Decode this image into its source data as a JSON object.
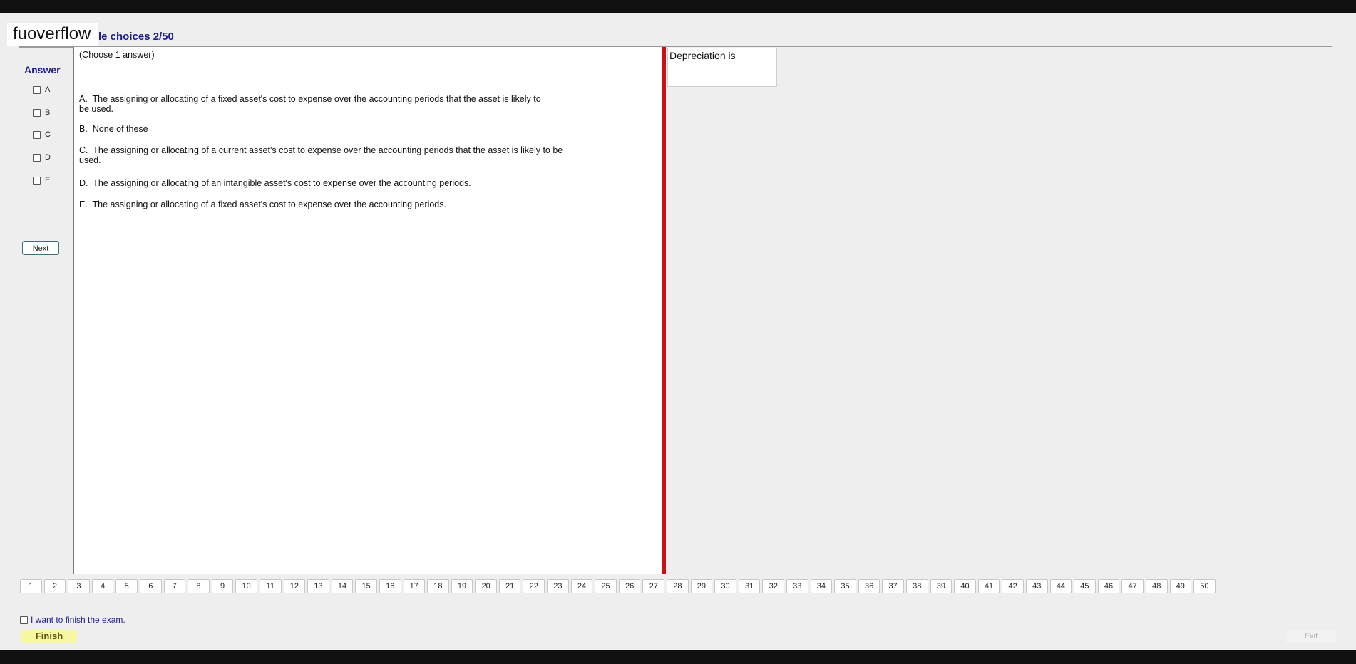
{
  "watermark": "fuoverflow",
  "exam_title": "le choices 2/50",
  "answer": {
    "heading": "Answer",
    "options": [
      "A",
      "B",
      "C",
      "D",
      "E"
    ],
    "next_label": "Next"
  },
  "question": {
    "instruction": "(Choose 1 answer)",
    "choices": [
      {
        "letter": "A.",
        "text": "The assigning or allocating of a fixed asset's cost to expense over the accounting periods that the asset is likely to be used."
      },
      {
        "letter": "B.",
        "text": "None of these"
      },
      {
        "letter": "C.",
        "text": "The assigning or allocating of a current asset's cost to expense over the accounting periods that the asset is likely to be used."
      },
      {
        "letter": "D.",
        "text": "The assigning or allocating of an intangible asset's cost to expense over the accounting periods."
      },
      {
        "letter": "E.",
        "text": "The assigning or allocating of a fixed asset's cost to expense over the accounting periods."
      }
    ],
    "stem": "Depreciation is"
  },
  "navigation": {
    "pages": [
      "1",
      "2",
      "3",
      "4",
      "5",
      "6",
      "7",
      "8",
      "9",
      "10",
      "11",
      "12",
      "13",
      "14",
      "15",
      "16",
      "17",
      "18",
      "19",
      "20",
      "21",
      "22",
      "23",
      "24",
      "25",
      "26",
      "27",
      "28",
      "29",
      "30",
      "31",
      "32",
      "33",
      "34",
      "35",
      "36",
      "37",
      "38",
      "39",
      "40",
      "41",
      "42",
      "43",
      "44",
      "45",
      "46",
      "47",
      "48",
      "49",
      "50"
    ]
  },
  "footer": {
    "finish_check_label": "I want to finish the exam.",
    "finish_label": "Finish",
    "exit_label": "Exit"
  },
  "colors": {
    "accent": "#1d1d8c",
    "splitter": "#cc0f12",
    "finish_bg": "#f6f7a0"
  }
}
